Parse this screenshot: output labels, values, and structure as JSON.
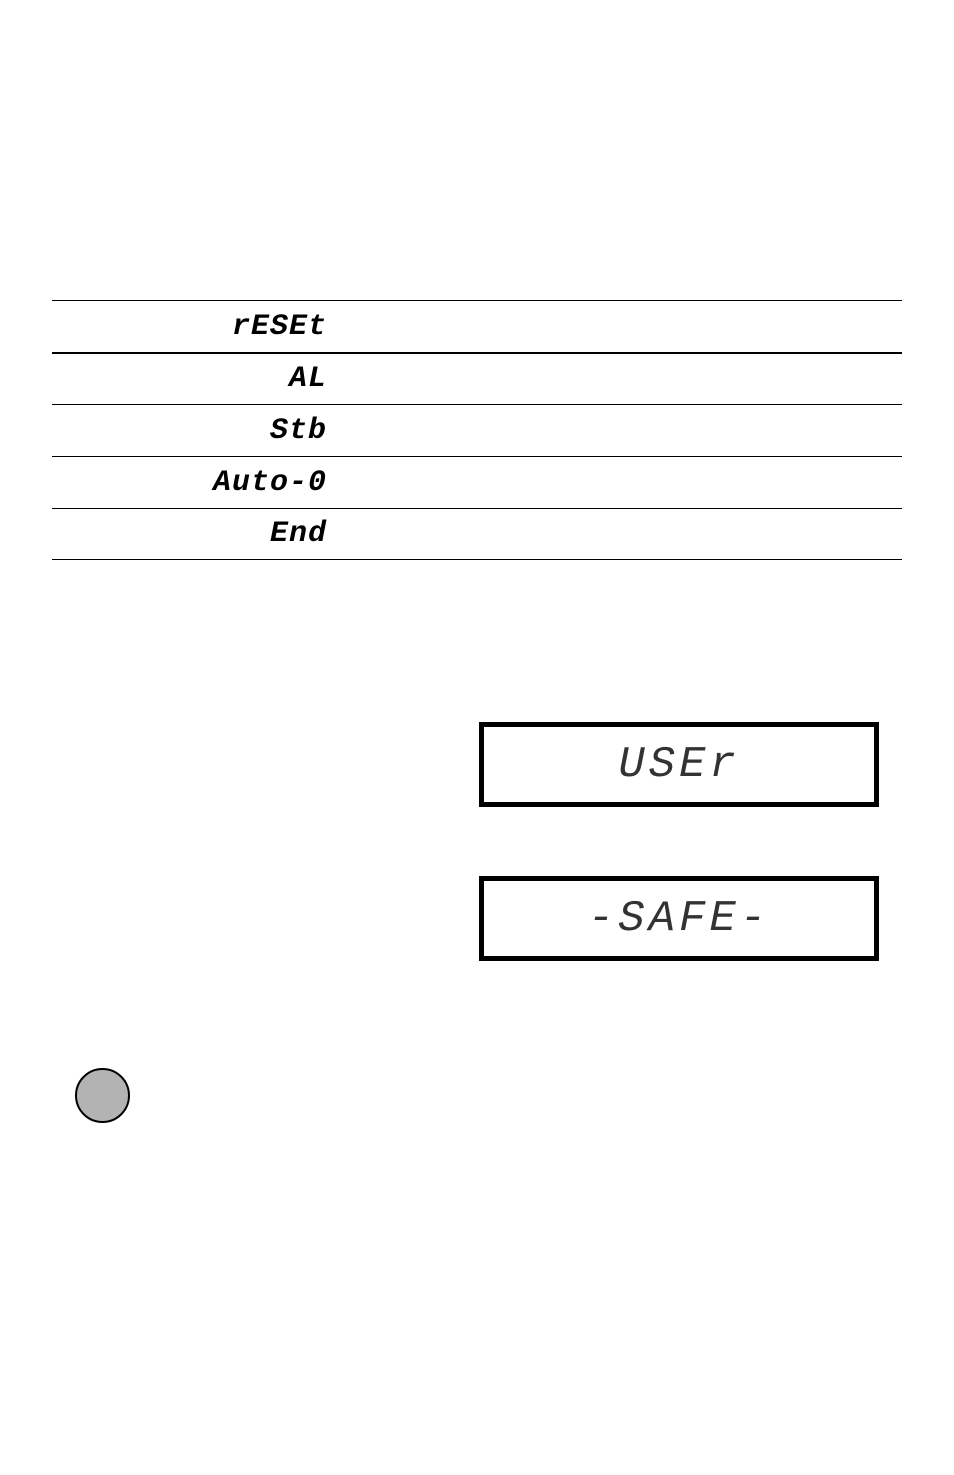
{
  "table": {
    "items": [
      {
        "label": "rESEt"
      },
      {
        "label": "AL"
      },
      {
        "label": "Stb"
      },
      {
        "label": "Auto-0"
      },
      {
        "label": "End"
      }
    ]
  },
  "displays": {
    "user": "USEr",
    "safe": "-SAFE-"
  }
}
